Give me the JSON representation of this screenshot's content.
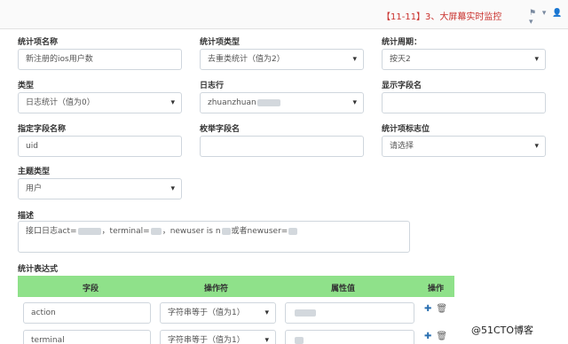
{
  "header": {
    "title": "【11-11】3、大屏幕实时监控",
    "icons": "⚑ ▾ 👤 ▾"
  },
  "form": {
    "row1": {
      "name_label": "统计项名称",
      "name_value": "新注册的ios用户数",
      "type_label": "统计项类型",
      "type_value": "去重类统计（值为2）",
      "period_label": "统计周期：",
      "period_value": "按天",
      "period_suffix": "2"
    },
    "row2": {
      "logtype_label": "类型",
      "logtype_value": "日志统计（值为0）",
      "logline_label": "日志行",
      "logline_value": "zhuanzhuan",
      "display_label": "显示字段名",
      "display_value": ""
    },
    "row3": {
      "field_label": "指定字段名称",
      "field_value": "uid",
      "enum_label": "枚举字段名",
      "enum_value": "",
      "flag_label": "统计项标志位",
      "flag_value": "请选择"
    },
    "row4": {
      "topic_label": "主题类型",
      "topic_value": "用户"
    },
    "desc": {
      "label": "描述",
      "part1": "接口日志act=",
      "part2": "，terminal=",
      "part3": "，newuser is n",
      "part4": "或者newuser="
    }
  },
  "expression": {
    "label": "统计表达式",
    "columns": [
      "字段",
      "操作符",
      "属性值",
      "操作"
    ],
    "rows": [
      {
        "field": "action",
        "operator": "字符串等于（值为1）"
      },
      {
        "field": "terminal",
        "operator": "字符串等于（值为1）"
      }
    ]
  },
  "watermark": "@51CTO博客"
}
